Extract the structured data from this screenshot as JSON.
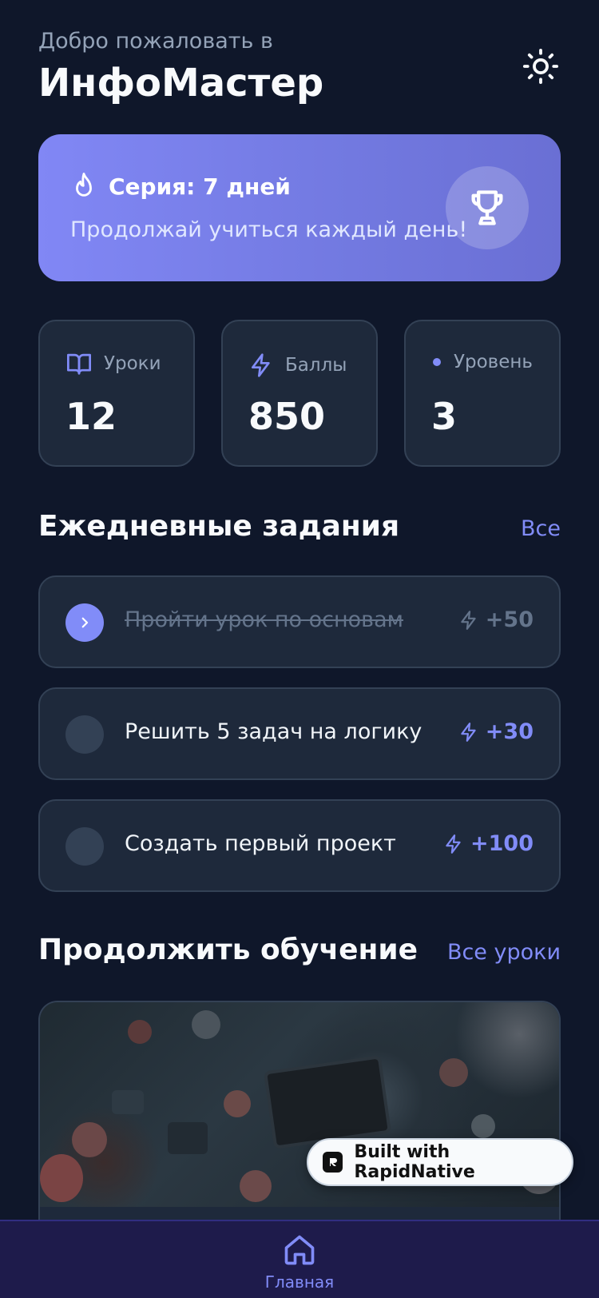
{
  "header": {
    "welcome": "Добро пожаловать в",
    "app_title": "ИнфоМастер",
    "theme_icon": "sun-icon"
  },
  "streak": {
    "title": "Серия: 7 дней",
    "subtitle": "Продолжай учиться каждый день!",
    "icon": "flame-icon",
    "badge_icon": "trophy-icon"
  },
  "stats": [
    {
      "label": "Уроки",
      "value": "12",
      "icon": "book-icon"
    },
    {
      "label": "Баллы",
      "value": "850",
      "icon": "lightning-icon"
    },
    {
      "label": "Уровень",
      "value": "3",
      "icon": "dot-icon"
    }
  ],
  "daily": {
    "title": "Ежедневные задания",
    "link": "Все",
    "tasks": [
      {
        "label": "Пройти урок по основам",
        "points": "+50",
        "done": true
      },
      {
        "label": "Решить 5 задач на логику",
        "points": "+30",
        "done": false
      },
      {
        "label": "Создать первый проект",
        "points": "+100",
        "done": false
      }
    ]
  },
  "continue": {
    "title": "Продолжить обучение",
    "link": "Все уроки"
  },
  "badge": {
    "text": "Built with RapidNative"
  },
  "tabbar": {
    "home_label": "Главная"
  },
  "colors": {
    "background": "#0f172a",
    "card": "#1e293b",
    "accent": "#818cf8",
    "streak_gradient_start": "#8187f5",
    "streak_gradient_end": "#6a6fd4"
  }
}
